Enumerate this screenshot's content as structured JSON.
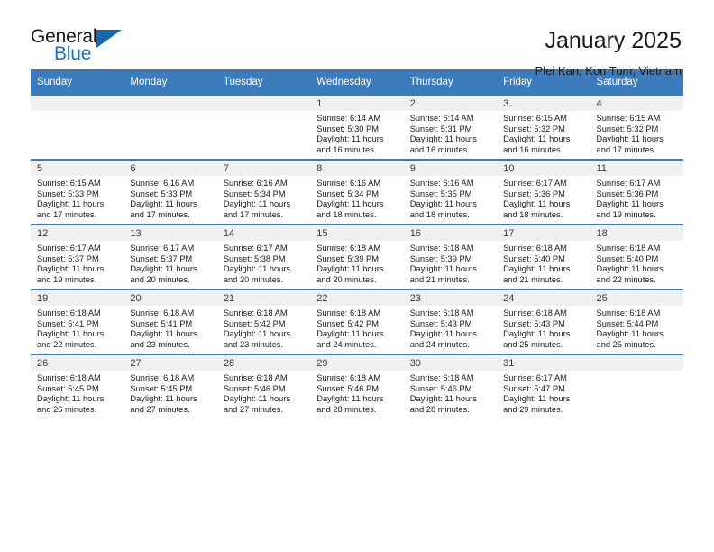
{
  "brand": {
    "word_one": "General",
    "word_two": "Blue",
    "logo_icon": "triangle-logo-icon",
    "accent_color": "#1567ae"
  },
  "header": {
    "title": "January 2025",
    "subtitle": "Plei Kan, Kon Tum, Vietnam"
  },
  "calendar": {
    "header_color": "#3c7cbd",
    "weekday_headers": [
      "Sunday",
      "Monday",
      "Tuesday",
      "Wednesday",
      "Thursday",
      "Friday",
      "Saturday"
    ],
    "weeks": [
      [
        {
          "day": "",
          "lines": []
        },
        {
          "day": "",
          "lines": []
        },
        {
          "day": "",
          "lines": []
        },
        {
          "day": "1",
          "lines": [
            "Sunrise: 6:14 AM",
            "Sunset: 5:30 PM",
            "Daylight: 11 hours",
            "and 16 minutes."
          ]
        },
        {
          "day": "2",
          "lines": [
            "Sunrise: 6:14 AM",
            "Sunset: 5:31 PM",
            "Daylight: 11 hours",
            "and 16 minutes."
          ]
        },
        {
          "day": "3",
          "lines": [
            "Sunrise: 6:15 AM",
            "Sunset: 5:32 PM",
            "Daylight: 11 hours",
            "and 16 minutes."
          ]
        },
        {
          "day": "4",
          "lines": [
            "Sunrise: 6:15 AM",
            "Sunset: 5:32 PM",
            "Daylight: 11 hours",
            "and 17 minutes."
          ]
        }
      ],
      [
        {
          "day": "5",
          "lines": [
            "Sunrise: 6:15 AM",
            "Sunset: 5:33 PM",
            "Daylight: 11 hours",
            "and 17 minutes."
          ]
        },
        {
          "day": "6",
          "lines": [
            "Sunrise: 6:16 AM",
            "Sunset: 5:33 PM",
            "Daylight: 11 hours",
            "and 17 minutes."
          ]
        },
        {
          "day": "7",
          "lines": [
            "Sunrise: 6:16 AM",
            "Sunset: 5:34 PM",
            "Daylight: 11 hours",
            "and 17 minutes."
          ]
        },
        {
          "day": "8",
          "lines": [
            "Sunrise: 6:16 AM",
            "Sunset: 5:34 PM",
            "Daylight: 11 hours",
            "and 18 minutes."
          ]
        },
        {
          "day": "9",
          "lines": [
            "Sunrise: 6:16 AM",
            "Sunset: 5:35 PM",
            "Daylight: 11 hours",
            "and 18 minutes."
          ]
        },
        {
          "day": "10",
          "lines": [
            "Sunrise: 6:17 AM",
            "Sunset: 5:36 PM",
            "Daylight: 11 hours",
            "and 18 minutes."
          ]
        },
        {
          "day": "11",
          "lines": [
            "Sunrise: 6:17 AM",
            "Sunset: 5:36 PM",
            "Daylight: 11 hours",
            "and 19 minutes."
          ]
        }
      ],
      [
        {
          "day": "12",
          "lines": [
            "Sunrise: 6:17 AM",
            "Sunset: 5:37 PM",
            "Daylight: 11 hours",
            "and 19 minutes."
          ]
        },
        {
          "day": "13",
          "lines": [
            "Sunrise: 6:17 AM",
            "Sunset: 5:37 PM",
            "Daylight: 11 hours",
            "and 20 minutes."
          ]
        },
        {
          "day": "14",
          "lines": [
            "Sunrise: 6:17 AM",
            "Sunset: 5:38 PM",
            "Daylight: 11 hours",
            "and 20 minutes."
          ]
        },
        {
          "day": "15",
          "lines": [
            "Sunrise: 6:18 AM",
            "Sunset: 5:39 PM",
            "Daylight: 11 hours",
            "and 20 minutes."
          ]
        },
        {
          "day": "16",
          "lines": [
            "Sunrise: 6:18 AM",
            "Sunset: 5:39 PM",
            "Daylight: 11 hours",
            "and 21 minutes."
          ]
        },
        {
          "day": "17",
          "lines": [
            "Sunrise: 6:18 AM",
            "Sunset: 5:40 PM",
            "Daylight: 11 hours",
            "and 21 minutes."
          ]
        },
        {
          "day": "18",
          "lines": [
            "Sunrise: 6:18 AM",
            "Sunset: 5:40 PM",
            "Daylight: 11 hours",
            "and 22 minutes."
          ]
        }
      ],
      [
        {
          "day": "19",
          "lines": [
            "Sunrise: 6:18 AM",
            "Sunset: 5:41 PM",
            "Daylight: 11 hours",
            "and 22 minutes."
          ]
        },
        {
          "day": "20",
          "lines": [
            "Sunrise: 6:18 AM",
            "Sunset: 5:41 PM",
            "Daylight: 11 hours",
            "and 23 minutes."
          ]
        },
        {
          "day": "21",
          "lines": [
            "Sunrise: 6:18 AM",
            "Sunset: 5:42 PM",
            "Daylight: 11 hours",
            "and 23 minutes."
          ]
        },
        {
          "day": "22",
          "lines": [
            "Sunrise: 6:18 AM",
            "Sunset: 5:42 PM",
            "Daylight: 11 hours",
            "and 24 minutes."
          ]
        },
        {
          "day": "23",
          "lines": [
            "Sunrise: 6:18 AM",
            "Sunset: 5:43 PM",
            "Daylight: 11 hours",
            "and 24 minutes."
          ]
        },
        {
          "day": "24",
          "lines": [
            "Sunrise: 6:18 AM",
            "Sunset: 5:43 PM",
            "Daylight: 11 hours",
            "and 25 minutes."
          ]
        },
        {
          "day": "25",
          "lines": [
            "Sunrise: 6:18 AM",
            "Sunset: 5:44 PM",
            "Daylight: 11 hours",
            "and 25 minutes."
          ]
        }
      ],
      [
        {
          "day": "26",
          "lines": [
            "Sunrise: 6:18 AM",
            "Sunset: 5:45 PM",
            "Daylight: 11 hours",
            "and 26 minutes."
          ]
        },
        {
          "day": "27",
          "lines": [
            "Sunrise: 6:18 AM",
            "Sunset: 5:45 PM",
            "Daylight: 11 hours",
            "and 27 minutes."
          ]
        },
        {
          "day": "28",
          "lines": [
            "Sunrise: 6:18 AM",
            "Sunset: 5:46 PM",
            "Daylight: 11 hours",
            "and 27 minutes."
          ]
        },
        {
          "day": "29",
          "lines": [
            "Sunrise: 6:18 AM",
            "Sunset: 5:46 PM",
            "Daylight: 11 hours",
            "and 28 minutes."
          ]
        },
        {
          "day": "30",
          "lines": [
            "Sunrise: 6:18 AM",
            "Sunset: 5:46 PM",
            "Daylight: 11 hours",
            "and 28 minutes."
          ]
        },
        {
          "day": "31",
          "lines": [
            "Sunrise: 6:17 AM",
            "Sunset: 5:47 PM",
            "Daylight: 11 hours",
            "and 29 minutes."
          ]
        },
        {
          "day": "",
          "lines": []
        }
      ]
    ]
  }
}
